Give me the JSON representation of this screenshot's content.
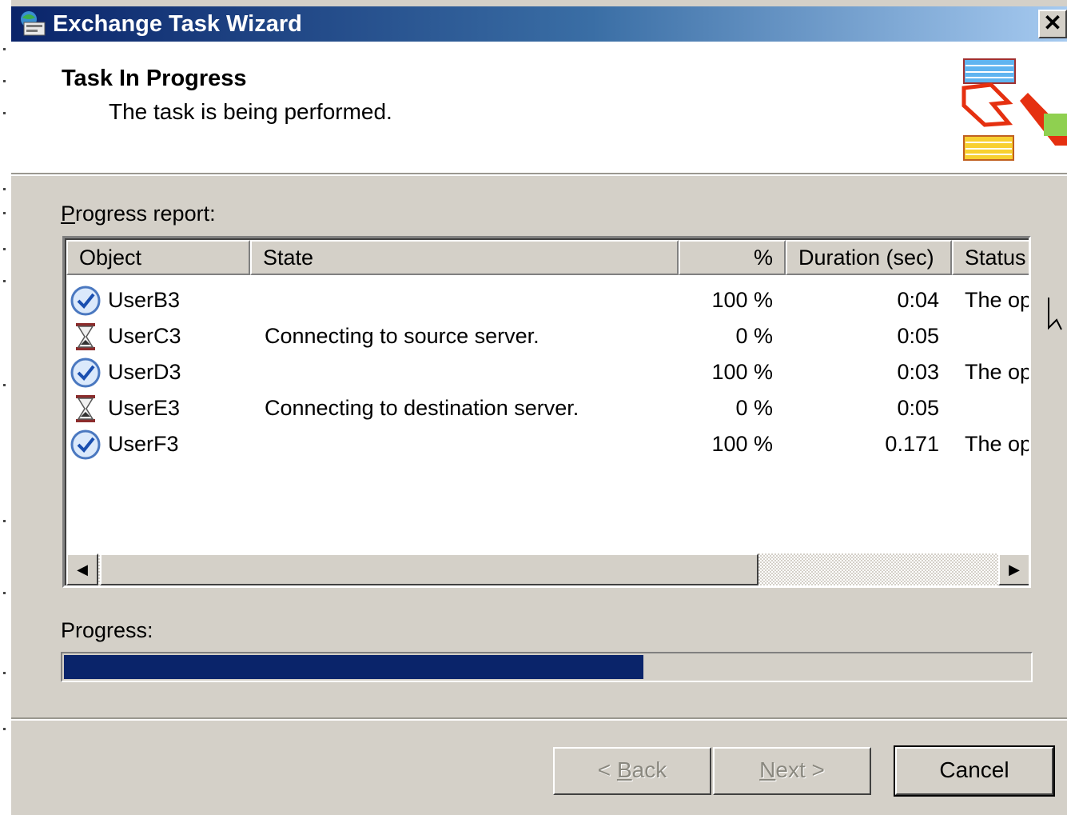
{
  "window": {
    "title": "Exchange Task Wizard",
    "close_glyph": "✕"
  },
  "header": {
    "title": "Task In Progress",
    "subtitle": "The task is being performed."
  },
  "progress_report": {
    "label_prefix": "P",
    "label_rest": "rogress report:",
    "columns": [
      "Object",
      "State",
      "%",
      "Duration (sec)",
      "Status"
    ],
    "rows": [
      {
        "icon": "checkmark-icon",
        "object": "UserB3",
        "state": "",
        "percent": "100 %",
        "duration": "0:04",
        "status": "The op"
      },
      {
        "icon": "hourglass-icon",
        "object": "UserC3",
        "state": "Connecting to source server.",
        "percent": "0 %",
        "duration": "0:05",
        "status": ""
      },
      {
        "icon": "checkmark-icon",
        "object": "UserD3",
        "state": "",
        "percent": "100 %",
        "duration": "0:03",
        "status": "The op"
      },
      {
        "icon": "hourglass-icon",
        "object": "UserE3",
        "state": "Connecting to destination server.",
        "percent": "0 %",
        "duration": "0:05",
        "status": ""
      },
      {
        "icon": "checkmark-icon",
        "object": "UserF3",
        "state": "",
        "percent": "100 %",
        "duration": "0.171",
        "status": "The op"
      }
    ]
  },
  "progress": {
    "label": "Progress:",
    "fraction": 0.6
  },
  "buttons": {
    "back_lt": "< ",
    "back_key": "B",
    "back_rest": "ack",
    "next_key": "N",
    "next_rest": "ext >",
    "cancel": "Cancel"
  },
  "colors": {
    "titlebar_start": "#0a246a",
    "titlebar_end": "#a6caf0",
    "progress_fill": "#0a246a",
    "face": "#d4d0c8"
  }
}
